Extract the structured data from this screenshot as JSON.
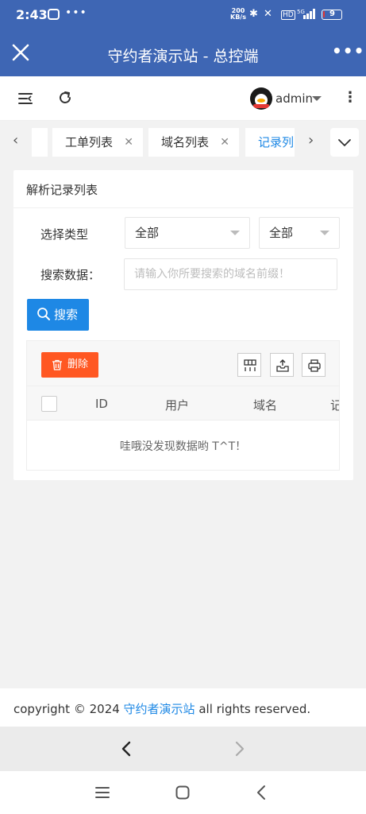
{
  "status_bar": {
    "time": "2:43",
    "net_speed_top": "200",
    "net_speed_unit": "KB/s",
    "battery": "9",
    "battery_fraction": 0.09
  },
  "app_bar": {
    "title": "守约者演示站 - 总控端"
  },
  "header": {
    "username": "admin"
  },
  "tabs": [
    {
      "label": "工单列表",
      "active": false
    },
    {
      "label": "域名列表",
      "active": false
    },
    {
      "label": "记录列",
      "active": true
    }
  ],
  "card": {
    "title": "解析记录列表",
    "type_label": "选择类型",
    "type_select_1": "全部",
    "type_select_2": "全部",
    "search_label": "搜索数据：",
    "search_placeholder": "请输入你所要搜索的域名前缀！",
    "search_button": "搜索",
    "delete_button": "删除",
    "columns": [
      "ID",
      "用户",
      "域名",
      "记"
    ],
    "empty_text": "哇哦没发现数据哟 T^T！"
  },
  "footer": {
    "prefix": "copyright © 2024 ",
    "brand": "守约者演示站",
    "suffix": " all rights reserved."
  },
  "colors": {
    "app_bar": "#3e66b4",
    "primary": "#1e88e5",
    "danger": "#ff5722"
  }
}
